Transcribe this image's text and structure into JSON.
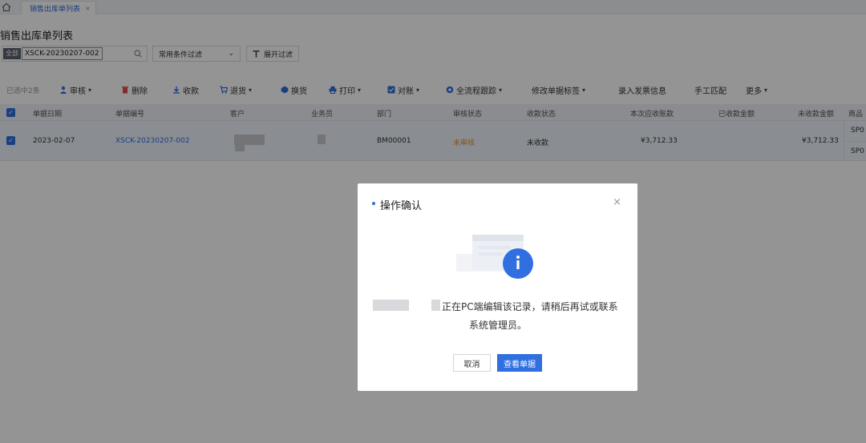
{
  "tab": {
    "label": "销售出库单列表",
    "close": "×"
  },
  "page_title": "销售出库单列表",
  "search": {
    "scope": "全部",
    "value": "XSCK-20230207-002"
  },
  "filter": {
    "label": "常用条件过滤"
  },
  "expand_filter": {
    "label": "展开过滤"
  },
  "toolbar": {
    "selected_count": "已选中2条",
    "audit": "审核",
    "delete": "删除",
    "receive": "收款",
    "return": "退货",
    "exchange": "换货",
    "print": "打印",
    "reconcile": "对账",
    "trace": "全流程跟踪",
    "edit_tags": "修改单据标签",
    "invoice": "录入发票信息",
    "manual_match": "手工匹配",
    "more": "更多"
  },
  "table": {
    "headers": [
      "单据日期",
      "单据编号",
      "客户",
      "业务员",
      "部门",
      "审核状态",
      "收款状态",
      "本次应收账款",
      "已收款金额",
      "未收款金额",
      "商品"
    ],
    "row": {
      "date": "2023-02-07",
      "number": "XSCK-20230207-002",
      "department": "BM00001",
      "audit_status": "未审核",
      "receipt_status": "未收款",
      "receivable": "¥3,712.33",
      "unreceived": "¥3,712.33",
      "goods_1": "SP0",
      "goods_2": "SP0"
    }
  },
  "modal": {
    "title": "操作确认",
    "close": "×",
    "message_line1": "正在PC端编辑该记录，请稍后再试或联系",
    "message_line2": "系统管理员。",
    "cancel": "取消",
    "view": "查看单据"
  },
  "colors": {
    "accent": "#2f6fe0",
    "audit_pending": "#e8912d",
    "delete_red": "#e5484d"
  }
}
